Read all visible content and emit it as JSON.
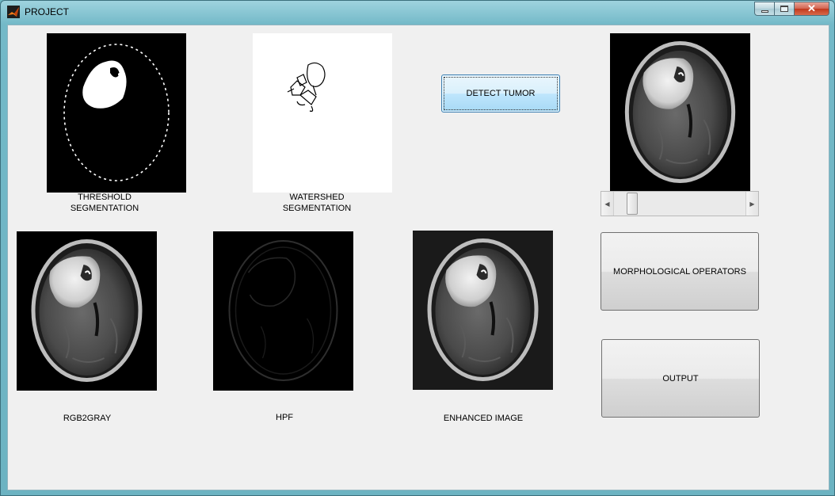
{
  "window": {
    "title": "PROJECT",
    "close_glyph": "✕"
  },
  "panels": {
    "threshold": {
      "label_line1": "THRESHOLD",
      "label_line2": "SEGMENTATION"
    },
    "watershed": {
      "label_line1": "WATERSHED",
      "label_line2": "SEGMENTATION"
    },
    "rgb2gray": {
      "label": "RGB2GRAY"
    },
    "hpf": {
      "label": "HPF"
    },
    "enhanced": {
      "label": "ENHANCED IMAGE"
    }
  },
  "buttons": {
    "detect": "DETECT TUMOR",
    "morph": "MORPHOLOGICAL OPERATORS",
    "output": "OUTPUT"
  },
  "slider": {
    "left_arrow": "◀",
    "right_arrow": "▶",
    "value": 0.1
  },
  "icons": [
    "matlab-icon",
    "minimize-icon",
    "maximize-icon",
    "close-icon",
    "brain-mri-image"
  ]
}
